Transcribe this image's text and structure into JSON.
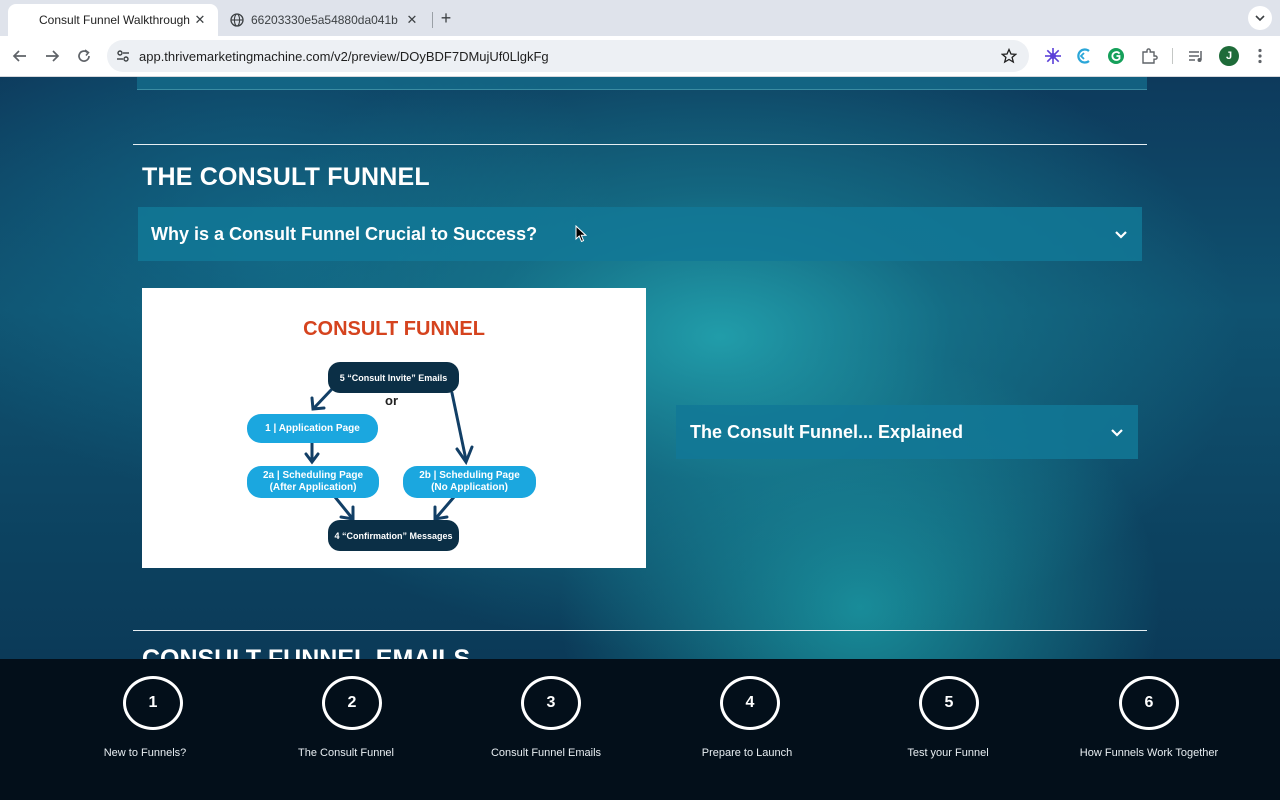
{
  "browser": {
    "tabs": [
      {
        "title": "Consult Funnel Walkthrough",
        "active": true
      },
      {
        "title": "66203330e5a54880da041b",
        "active": false
      }
    ],
    "url": "app.thrivemarketingmachine.com/v2/preview/DOyBDF7DMujUf0LlgkFg",
    "profile_initial": "J"
  },
  "page": {
    "section_title": "THE CONSULT FUNNEL",
    "accordion_why": "Why is a Consult Funnel Crucial to Success?",
    "accordion_explained": "The Consult Funnel... Explained",
    "next_section_title": "CONSULT FUNNEL EMAILS"
  },
  "diagram": {
    "title": "CONSULT FUNNEL",
    "or_label": "or",
    "nodes": {
      "invite": "5 “Consult Invite” Emails",
      "application": "1 | Application Page",
      "sched_a_line1": "2a | Scheduling Page",
      "sched_a_line2": "(After Application)",
      "sched_b_line1": "2b | Scheduling Page",
      "sched_b_line2": "(No Application)",
      "confirmation": "4 “Confirmation” Messages"
    },
    "colors": {
      "title": "#d5431e",
      "dark_node": "#0b2f46",
      "light_node": "#1ba7df",
      "arrow": "#123f66"
    }
  },
  "steps": [
    {
      "number": "1",
      "label": "New to Funnels?"
    },
    {
      "number": "2",
      "label": "The Consult Funnel"
    },
    {
      "number": "3",
      "label": "Consult Funnel Emails"
    },
    {
      "number": "4",
      "label": "Prepare to Launch"
    },
    {
      "number": "5",
      "label": "Test your Funnel"
    },
    {
      "number": "6",
      "label": "How Funnels Work Together"
    }
  ]
}
